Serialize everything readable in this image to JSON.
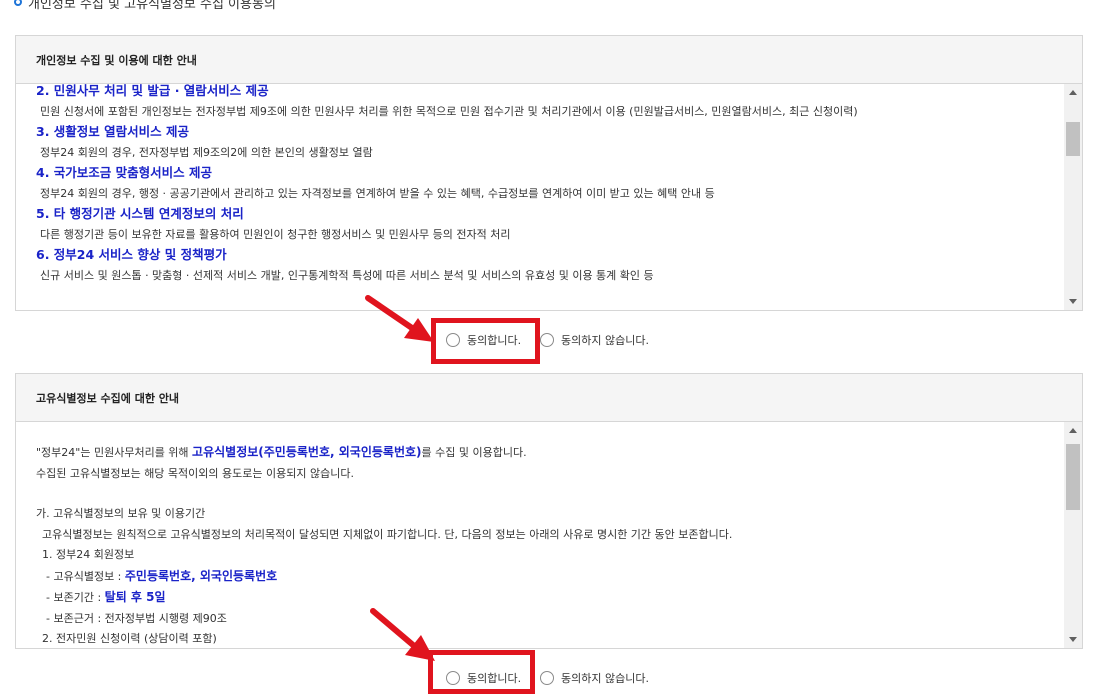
{
  "section_title": "개인정보 수집 및 고유식별정보 수집 이용동의",
  "personal_info": {
    "heading": "개인정보 수집 및 이용에 대한 안내",
    "items": [
      {
        "title": "2. 민원사무 처리 및 발급 · 열람서비스 제공",
        "desc": "민원 신청서에 포함된 개인정보는 전자정부법 제9조에 의한 민원사무 처리를 위한 목적으로 민원 접수기관 및 처리기관에서 이용 (민원발급서비스, 민원열람서비스, 최근 신청이력)"
      },
      {
        "title": "3. 생활정보 열람서비스 제공",
        "desc": "정부24 회원의 경우, 전자정부법 제9조의2에 의한 본인의 생활정보 열람"
      },
      {
        "title": "4. 국가보조금 맞춤형서비스 제공",
        "desc": "정부24 회원의 경우, 행정 · 공공기관에서 관리하고 있는 자격정보를 연계하여 받을 수 있는 혜택, 수급정보를 연계하여 이미 받고 있는 혜택 안내 등"
      },
      {
        "title": "5. 타 행정기관 시스템 연계정보의 처리",
        "desc": "다른 행정기관 등이 보유한 자료를 활용하여 민원인이 청구한 행정서비스 및 민원사무 등의 전자적 처리"
      },
      {
        "title": "6. 정부24 서비스 향상 및 정책평가",
        "desc": "신규 서비스 및 원스톱 · 맞춤형 · 선제적 서비스 개발, 인구통계학적 특성에 따른 서비스 분석 및 서비스의 유효성 및 이용 통계 확인 등"
      }
    ],
    "agree_label": "동의합니다.",
    "disagree_label": "동의하지 않습니다."
  },
  "unique_id": {
    "heading": "고유식별정보 수집에 대한 안내",
    "intro_prefix": "\"정부24\"는 민원사무처리를 위해 ",
    "intro_highlight": "고유식별정보(주민등록번호, 외국인등록번호)",
    "intro_suffix": "를 수집 및 이용합니다.",
    "intro_line2": "수집된 고유식별정보는 해당 목적이외의 용도로는 이용되지 않습니다.",
    "sub_title": "가. 고유식별정보의 보유 및 이용기간",
    "sub_desc": "고유식별정보는 원칙적으로 고유식별정보의 처리목적이 달성되면 지체없이 파기합니다. 단, 다음의 정보는 아래의 사유로 명시한 기간 동안 보존합니다.",
    "member_title": "1. 정부24 회원정보",
    "id_label": "- 고유식별정보 : ",
    "id_value": "주민등록번호, 외국인등록번호",
    "period_label": "- 보존기간 : ",
    "period_value": "탈퇴 후 5일",
    "basis_label": "- 보존근거 : 전자정부법 시행령 제90조",
    "history_title": "2. 전자민원 신청이력 (상담이력 포함)",
    "agree_label": "동의합니다.",
    "disagree_label": "동의하지 않습니다."
  },
  "colors": {
    "accent": "#1a23c8",
    "highlight_box": "#e0141e",
    "bullet": "#1e74d8"
  }
}
